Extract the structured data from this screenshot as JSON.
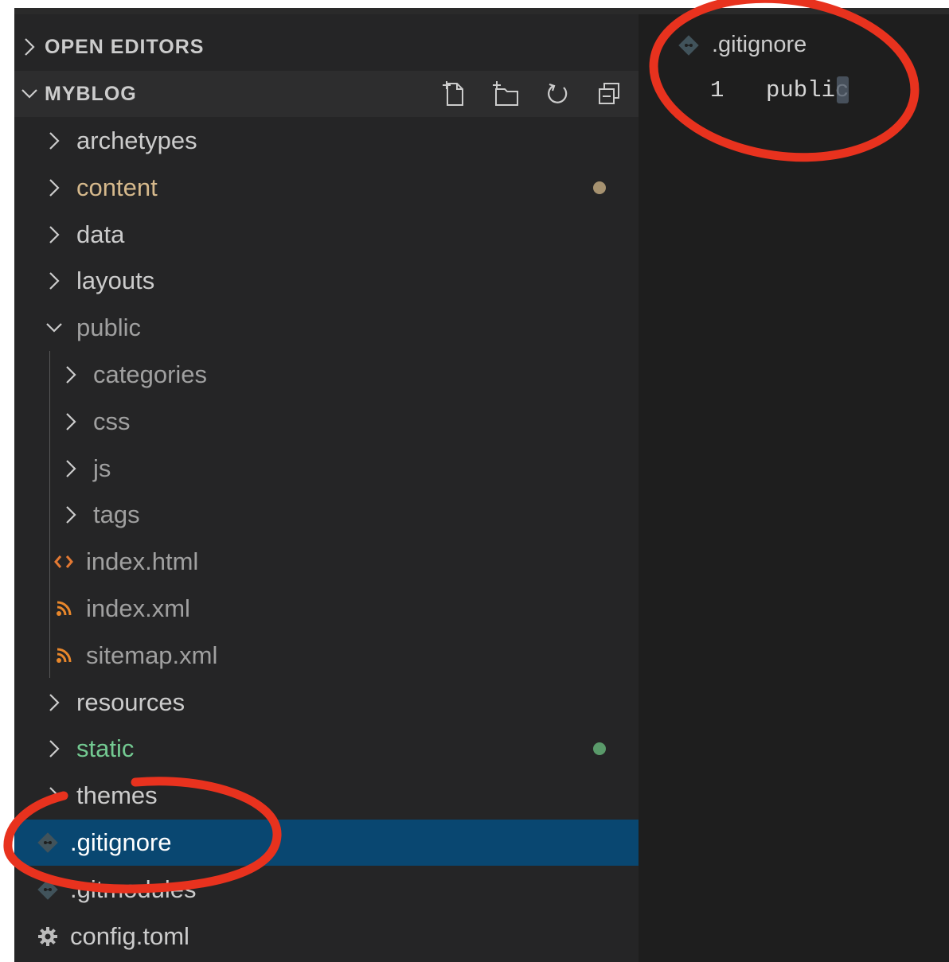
{
  "sidebar": {
    "open_editors_label": "OPEN EDITORS",
    "project_label": "MYBLOG",
    "actions": [
      {
        "name": "new-file-icon"
      },
      {
        "name": "new-folder-icon"
      },
      {
        "name": "refresh-icon"
      },
      {
        "name": "collapse-all-icon"
      }
    ],
    "tree": [
      {
        "label": "archetypes",
        "type": "folder",
        "expanded": false,
        "depth": 0,
        "color": "#cccccc"
      },
      {
        "label": "content",
        "type": "folder",
        "expanded": false,
        "depth": 0,
        "color": "#d6b98c",
        "status_dot": "#a69270"
      },
      {
        "label": "data",
        "type": "folder",
        "expanded": false,
        "depth": 0,
        "color": "#cccccc"
      },
      {
        "label": "layouts",
        "type": "folder",
        "expanded": false,
        "depth": 0,
        "color": "#cccccc"
      },
      {
        "label": "public",
        "type": "folder",
        "expanded": true,
        "depth": 0,
        "color": "#a0a0a0"
      },
      {
        "label": "categories",
        "type": "folder",
        "expanded": false,
        "depth": 1,
        "color": "#a0a0a0"
      },
      {
        "label": "css",
        "type": "folder",
        "expanded": false,
        "depth": 1,
        "color": "#a0a0a0"
      },
      {
        "label": "js",
        "type": "folder",
        "expanded": false,
        "depth": 1,
        "color": "#a0a0a0"
      },
      {
        "label": "tags",
        "type": "folder",
        "expanded": false,
        "depth": 1,
        "color": "#a0a0a0"
      },
      {
        "label": "index.html",
        "type": "file",
        "icon": "html-icon",
        "depth": 1,
        "color": "#a0a0a0"
      },
      {
        "label": "index.xml",
        "type": "file",
        "icon": "rss-icon",
        "depth": 1,
        "color": "#a0a0a0"
      },
      {
        "label": "sitemap.xml",
        "type": "file",
        "icon": "rss-icon",
        "depth": 1,
        "color": "#a0a0a0"
      },
      {
        "label": "resources",
        "type": "folder",
        "expanded": false,
        "depth": 0,
        "color": "#cccccc"
      },
      {
        "label": "static",
        "type": "folder",
        "expanded": false,
        "depth": 0,
        "color": "#73c991",
        "status_dot": "#5a9a6a"
      },
      {
        "label": "themes",
        "type": "folder",
        "expanded": false,
        "depth": 0,
        "color": "#cccccc"
      },
      {
        "label": ".gitignore",
        "type": "file",
        "icon": "git-icon",
        "depth": 0,
        "color": "#ffffff",
        "selected": true
      },
      {
        "label": ".gitmodules",
        "type": "file",
        "icon": "git-icon",
        "depth": 0,
        "color": "#cccccc"
      },
      {
        "label": "config.toml",
        "type": "file",
        "icon": "gear-icon",
        "depth": 0,
        "color": "#cccccc"
      }
    ]
  },
  "editor": {
    "tab_title": ".gitignore",
    "tab_icon": "git-icon",
    "lines": [
      {
        "number": "1",
        "text": "public"
      }
    ]
  },
  "colors": {
    "selection": "#094771",
    "annotation": "#e8321e",
    "html_icon": "#e37933",
    "rss_icon": "#e8872b",
    "git_icon": "#41535b"
  }
}
